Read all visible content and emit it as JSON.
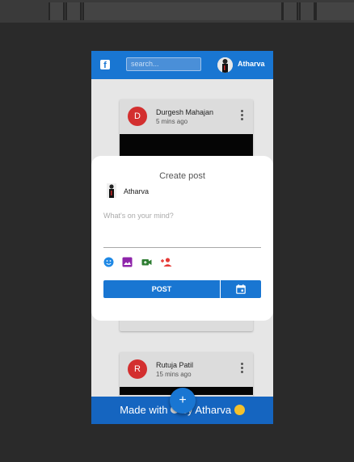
{
  "app": {
    "search_placeholder": "search...",
    "user_name": "Atharva",
    "brand_icon": "facebook-icon",
    "accent": "#1976d2"
  },
  "posts": [
    {
      "avatar_letter": "D",
      "author": "Durgesh Mahajan",
      "time": "5 mins ago"
    },
    {
      "avatar_letter": "R",
      "author": "Rutuja Patil",
      "time": "15 mins ago"
    }
  ],
  "footer": {
    "text_before": "Made with",
    "text_after": "by Atharva"
  },
  "fab": {
    "label": "+"
  },
  "modal": {
    "title": "Create post",
    "user_name": "Atharva",
    "placeholder": "What's on your mind?",
    "post_label": "POST",
    "icons": [
      "emoji-icon",
      "image-icon",
      "video-icon",
      "tag-person-icon",
      "calendar-icon"
    ]
  }
}
